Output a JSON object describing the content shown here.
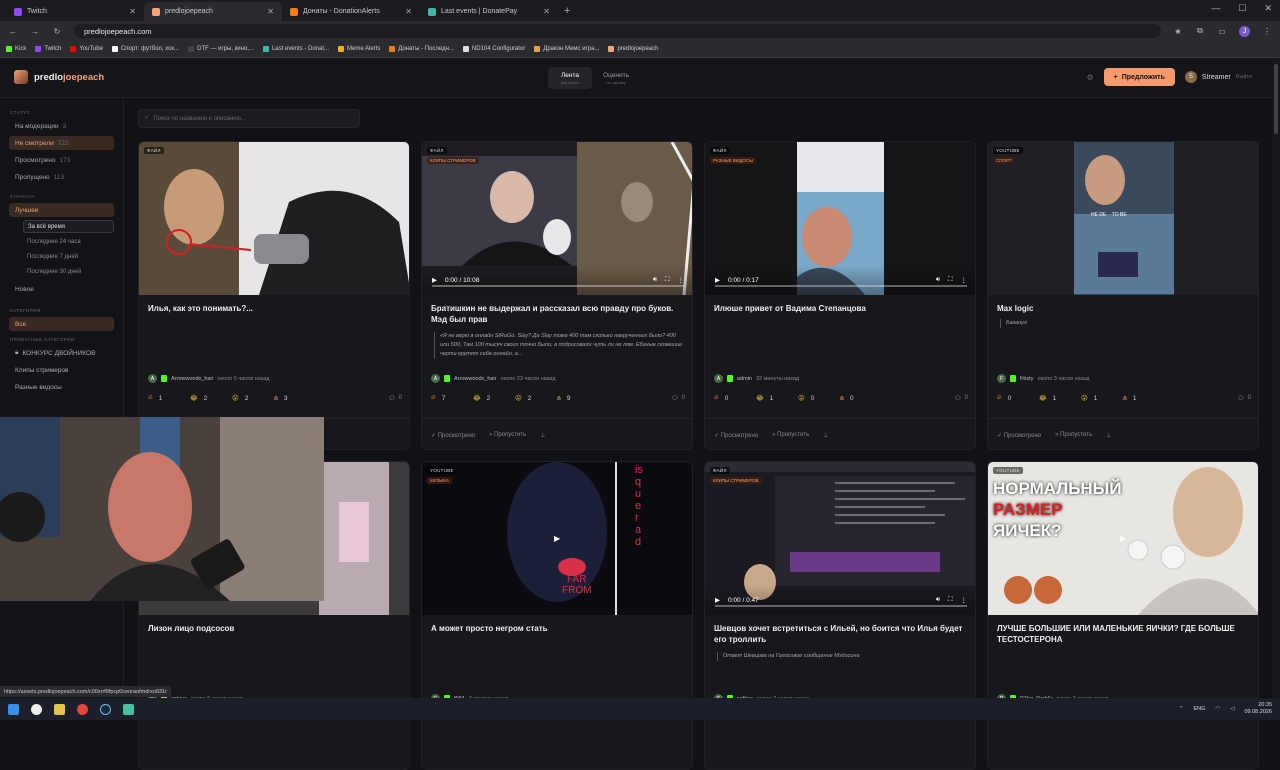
{
  "browser": {
    "tabs": [
      {
        "title": "Twitch",
        "color": "#9146ff"
      },
      {
        "title": "predlojoepeach",
        "color": "#f4a374"
      },
      {
        "title": "Донаты - DonationAlerts",
        "color": "#f57d07"
      },
      {
        "title": "Last events | DonatePay",
        "color": "#3bb9a4"
      }
    ],
    "url": "predlojoepeach.com",
    "profile_initial": "J",
    "bookmarks": [
      {
        "label": "Kick",
        "color": "#53fc18"
      },
      {
        "label": "Twitch",
        "color": "#9146ff"
      },
      {
        "label": "YouTube",
        "color": "#ff0000"
      },
      {
        "label": "Спорт: футбол, хок...",
        "color": "#ffffff"
      },
      {
        "label": "DTF — игры, кино,...",
        "color": "#444444"
      },
      {
        "label": "Last events - Donat...",
        "color": "#3bb9a4"
      },
      {
        "label": "Meme Alerts",
        "color": "#f4b400"
      },
      {
        "label": "Донаты - Последн...",
        "color": "#f57d07"
      },
      {
        "label": "ND104 Configurator",
        "color": "#dddddd"
      },
      {
        "label": "Дракон Мемс игра...",
        "color": "#e8a33d"
      },
      {
        "label": "predlojoepeach",
        "color": "#f4a374"
      }
    ]
  },
  "header": {
    "logo_main": "predlo",
    "logo_accent": "joepeach",
    "nav": [
      {
        "label": "Лента",
        "sub": "все обоих"
      },
      {
        "label": "Оценить",
        "sub": "по одному"
      }
    ],
    "suggest_label": "Предложить",
    "user_initial": "S",
    "user_name": "Streamer",
    "logout": "Выйти"
  },
  "sidebar": {
    "status_title": "СТАТУС",
    "status": [
      {
        "label": "На модерации",
        "count": "3"
      },
      {
        "label": "Не смотрели",
        "count": "722"
      },
      {
        "label": "Просмотрено",
        "count": "173"
      },
      {
        "label": "Пропущено",
        "count": "113"
      }
    ],
    "sort_title": "СНАЧАЛА",
    "best": "Лучшее",
    "periods": [
      "За всё время",
      "Последние 24 часа",
      "Последние 7 дней",
      "Последние 30 дней"
    ],
    "new": "Новое",
    "cat_title": "КАТЕГОРИЯ",
    "all": "Все",
    "private_title": "ПРИВАТНЫЕ КАТЕГОРИИ",
    "categories": [
      "КОНКУРС ДВОЙНИКОВ",
      "Клипы стримеров",
      "Разные видосы"
    ]
  },
  "search_placeholder": "Поиск по названию и описанию...",
  "cards": [
    {
      "badge": "ФАЙЛ",
      "badge2": "",
      "title": "Илья, как это понимать?...",
      "desc": "",
      "author": "Arrowwoods_hair",
      "time": "около 5 часов назад",
      "reacts": [
        "1",
        "2",
        "2",
        "3"
      ],
      "comments": "0",
      "video": false,
      "time_code": ""
    },
    {
      "badge": "ФАЙЛ",
      "badge2": "КЛИПЫ СТРИМЕРОВ",
      "title": "Братишкин не выдержал и рассказал всю правду про буков. Мэд был прав",
      "desc": "«Я не верю в онлайн StRoGo. Slay? Да Slay тоже 400 там сколько накрученных было? 400 или 500, Там 100 тысяч своих точно было, а подрисовали чуть ли не лям. Ебаные сковешие черти крутят себе онлайн, а...",
      "author": "Arrowwoods_hair",
      "time": "около 23 часов назад",
      "reacts": [
        "7",
        "2",
        "2",
        "9"
      ],
      "comments": "0",
      "video": true,
      "time_code": "0:00 / 10:08"
    },
    {
      "badge": "ФАЙЛ",
      "badge2": "РАЗНЫЕ ВИДОСЫ",
      "title": "Илюше привет от Вадима Степанцова",
      "desc": "",
      "author": "admin",
      "time": "32 минуты назад",
      "reacts": [
        "0",
        "1",
        "0",
        "0"
      ],
      "comments": "0",
      "video": true,
      "time_code": "0:00 / 0:17"
    },
    {
      "badge": "YOUTUBE",
      "badge2": "СПОРТ",
      "title": "Max logic",
      "desc": "Базанул",
      "author": "frbsty",
      "time": "около 3 часов назад",
      "reacts": [
        "0",
        "1",
        "1",
        "1"
      ],
      "comments": "0",
      "video": false,
      "time_code": ""
    },
    {
      "badge": "",
      "badge2": "",
      "title": "Лизон лицо подсосов",
      "desc": "",
      "author": "sntzus",
      "time": "около 5 часов назад",
      "reacts": [],
      "comments": "",
      "video": false,
      "time_code": ""
    },
    {
      "badge": "YOUTUBE",
      "badge2": "МУЗЫКА",
      "title": "А может просто негром стать",
      "desc": "",
      "author": "f984",
      "time": "3 месяца назад",
      "reacts": [],
      "comments": "",
      "video": false,
      "time_code": ""
    },
    {
      "badge": "ФАЙЛ",
      "badge2": "КЛИПЫ СТРИМЕРОВ",
      "title": "Шевцов хочет встретиться с Ильей, но боится что Илья будет его троллить",
      "desc": "Ответ Шевцова на Голосовое сообщение Мэдисона",
      "author": "softize",
      "time": "около 2 часов назад",
      "reacts": [],
      "comments": "",
      "video": true,
      "time_code": "0:00 / 0:47"
    },
    {
      "badge": "YOUTUBE",
      "badge2": "",
      "title": "ЛУЧШЕ БОЛЬШИЕ ИЛИ МАЛЕНЬКИЕ ЯИЧКИ? ГДЕ БОЛЬШЕ ТЕСТОСТЕРОНА",
      "desc": "",
      "author": "P7ter_Park6r",
      "time": "около 3 часов назад",
      "reacts": [],
      "comments": "",
      "video": false,
      "time_code": ""
    }
  ],
  "thumb_text": {
    "hede": "HE DE    TO BE",
    "far_from": "FAR\nFROM",
    "squared": "isquerad",
    "yt_line1": "НОРМАЛЬНЫЙ",
    "yt_line2": "РАЗМЕР",
    "yt_line3": "ЯИЧЕК?"
  },
  "action_labels": {
    "viewed": "Просмотрено",
    "skip": "Пропустить"
  },
  "status_url": "https://assets.predlojoepeach.com/c00xrrf9fpcp0ceoraofmdrxo831r",
  "taskbar": {
    "lang": "ENG",
    "time": "20:35",
    "date": "09.08.2026"
  }
}
